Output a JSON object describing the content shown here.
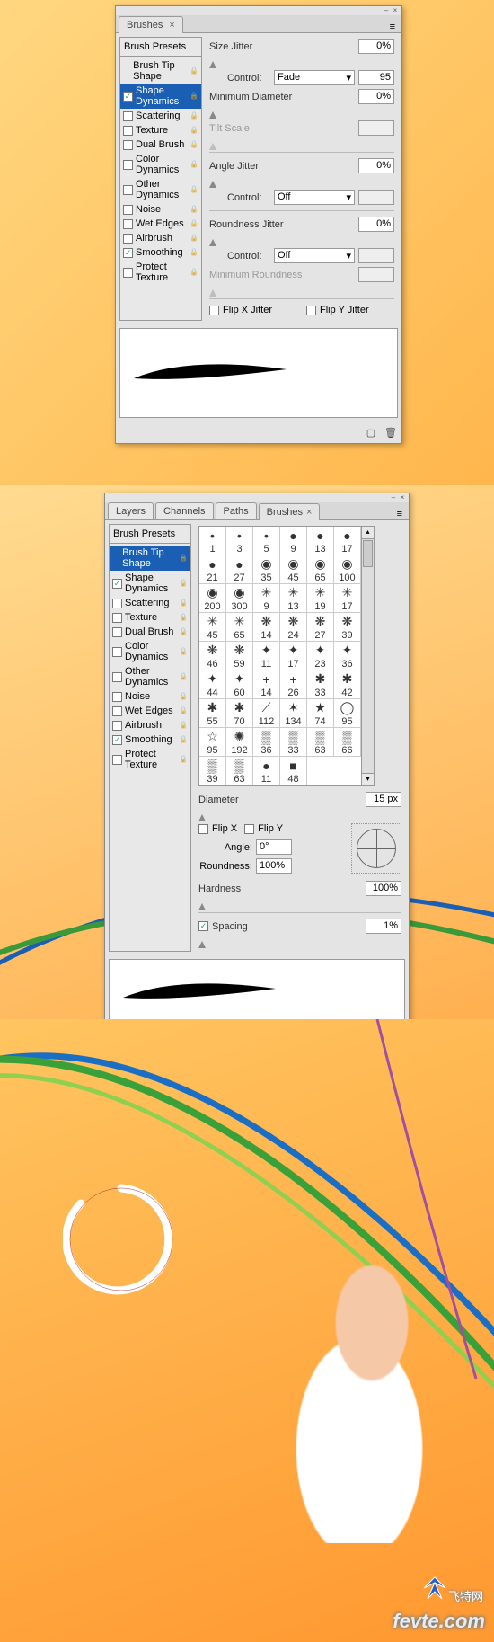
{
  "panel1": {
    "tab": "Brushes",
    "presets": "Brush Presets",
    "options": [
      {
        "label": "Brush Tip Shape",
        "checkbox": false,
        "checked": false,
        "lock": true,
        "selected": false
      },
      {
        "label": "Shape Dynamics",
        "checkbox": true,
        "checked": true,
        "lock": true,
        "selected": true
      },
      {
        "label": "Scattering",
        "checkbox": true,
        "checked": false,
        "lock": true,
        "selected": false
      },
      {
        "label": "Texture",
        "checkbox": true,
        "checked": false,
        "lock": true,
        "selected": false
      },
      {
        "label": "Dual Brush",
        "checkbox": true,
        "checked": false,
        "lock": true,
        "selected": false
      },
      {
        "label": "Color Dynamics",
        "checkbox": true,
        "checked": false,
        "lock": true,
        "selected": false
      },
      {
        "label": "Other Dynamics",
        "checkbox": true,
        "checked": false,
        "lock": true,
        "selected": false
      },
      {
        "label": "Noise",
        "checkbox": true,
        "checked": false,
        "lock": true,
        "selected": false
      },
      {
        "label": "Wet Edges",
        "checkbox": true,
        "checked": false,
        "lock": true,
        "selected": false
      },
      {
        "label": "Airbrush",
        "checkbox": true,
        "checked": false,
        "lock": true,
        "selected": false
      },
      {
        "label": "Smoothing",
        "checkbox": true,
        "checked": true,
        "lock": true,
        "selected": false
      },
      {
        "label": "Protect Texture",
        "checkbox": true,
        "checked": false,
        "lock": true,
        "selected": false
      }
    ],
    "sizeJitter": {
      "label": "Size Jitter",
      "value": "0%"
    },
    "control1": {
      "label": "Control:",
      "value": "Fade",
      "num": "95"
    },
    "minDiameter": {
      "label": "Minimum Diameter",
      "value": "0%"
    },
    "tiltScale": {
      "label": "Tilt Scale"
    },
    "angleJitter": {
      "label": "Angle Jitter",
      "value": "0%"
    },
    "control2": {
      "label": "Control:",
      "value": "Off"
    },
    "roundnessJitter": {
      "label": "Roundness Jitter",
      "value": "0%"
    },
    "control3": {
      "label": "Control:",
      "value": "Off"
    },
    "minRoundness": {
      "label": "Minimum Roundness"
    },
    "flipX": {
      "label": "Flip X Jitter",
      "checked": false
    },
    "flipY": {
      "label": "Flip Y Jitter",
      "checked": false
    }
  },
  "panel2": {
    "tabs": [
      "Layers",
      "Channels",
      "Paths",
      "Brushes"
    ],
    "activeTab": "Brushes",
    "presets": "Brush Presets",
    "options": [
      {
        "label": "Brush Tip Shape",
        "checkbox": false,
        "checked": false,
        "lock": true,
        "selected": true
      },
      {
        "label": "Shape Dynamics",
        "checkbox": true,
        "checked": true,
        "lock": true,
        "selected": false
      },
      {
        "label": "Scattering",
        "checkbox": true,
        "checked": false,
        "lock": true,
        "selected": false
      },
      {
        "label": "Texture",
        "checkbox": true,
        "checked": false,
        "lock": true,
        "selected": false
      },
      {
        "label": "Dual Brush",
        "checkbox": true,
        "checked": false,
        "lock": true,
        "selected": false
      },
      {
        "label": "Color Dynamics",
        "checkbox": true,
        "checked": false,
        "lock": true,
        "selected": false
      },
      {
        "label": "Other Dynamics",
        "checkbox": true,
        "checked": false,
        "lock": true,
        "selected": false
      },
      {
        "label": "Noise",
        "checkbox": true,
        "checked": false,
        "lock": true,
        "selected": false
      },
      {
        "label": "Wet Edges",
        "checkbox": true,
        "checked": false,
        "lock": true,
        "selected": false
      },
      {
        "label": "Airbrush",
        "checkbox": true,
        "checked": false,
        "lock": true,
        "selected": false
      },
      {
        "label": "Smoothing",
        "checkbox": true,
        "checked": true,
        "lock": true,
        "selected": false
      },
      {
        "label": "Protect Texture",
        "checkbox": true,
        "checked": false,
        "lock": true,
        "selected": false
      }
    ],
    "brushSizes": [
      "1",
      "3",
      "5",
      "9",
      "13",
      "17",
      "21",
      "27",
      "35",
      "45",
      "65",
      "100",
      "200",
      "300",
      "9",
      "13",
      "19",
      "17",
      "45",
      "65",
      "14",
      "24",
      "27",
      "39",
      "46",
      "59",
      "11",
      "17",
      "23",
      "36",
      "44",
      "60",
      "14",
      "26",
      "33",
      "42",
      "55",
      "70",
      "112",
      "134",
      "74",
      "95",
      "95",
      "192",
      "36",
      "33",
      "63",
      "66",
      "39",
      "63",
      "11",
      "48"
    ],
    "diameter": {
      "label": "Diameter",
      "value": "15 px"
    },
    "flipX": {
      "label": "Flip X",
      "checked": false
    },
    "flipY": {
      "label": "Flip Y",
      "checked": false
    },
    "angle": {
      "label": "Angle:",
      "value": "0°"
    },
    "roundness": {
      "label": "Roundness:",
      "value": "100%"
    },
    "hardness": {
      "label": "Hardness",
      "value": "100%"
    },
    "spacing": {
      "label": "Spacing",
      "checked": true,
      "value": "1%"
    }
  },
  "watermark": {
    "text": "fevte.com",
    "brand": "飞特网"
  }
}
